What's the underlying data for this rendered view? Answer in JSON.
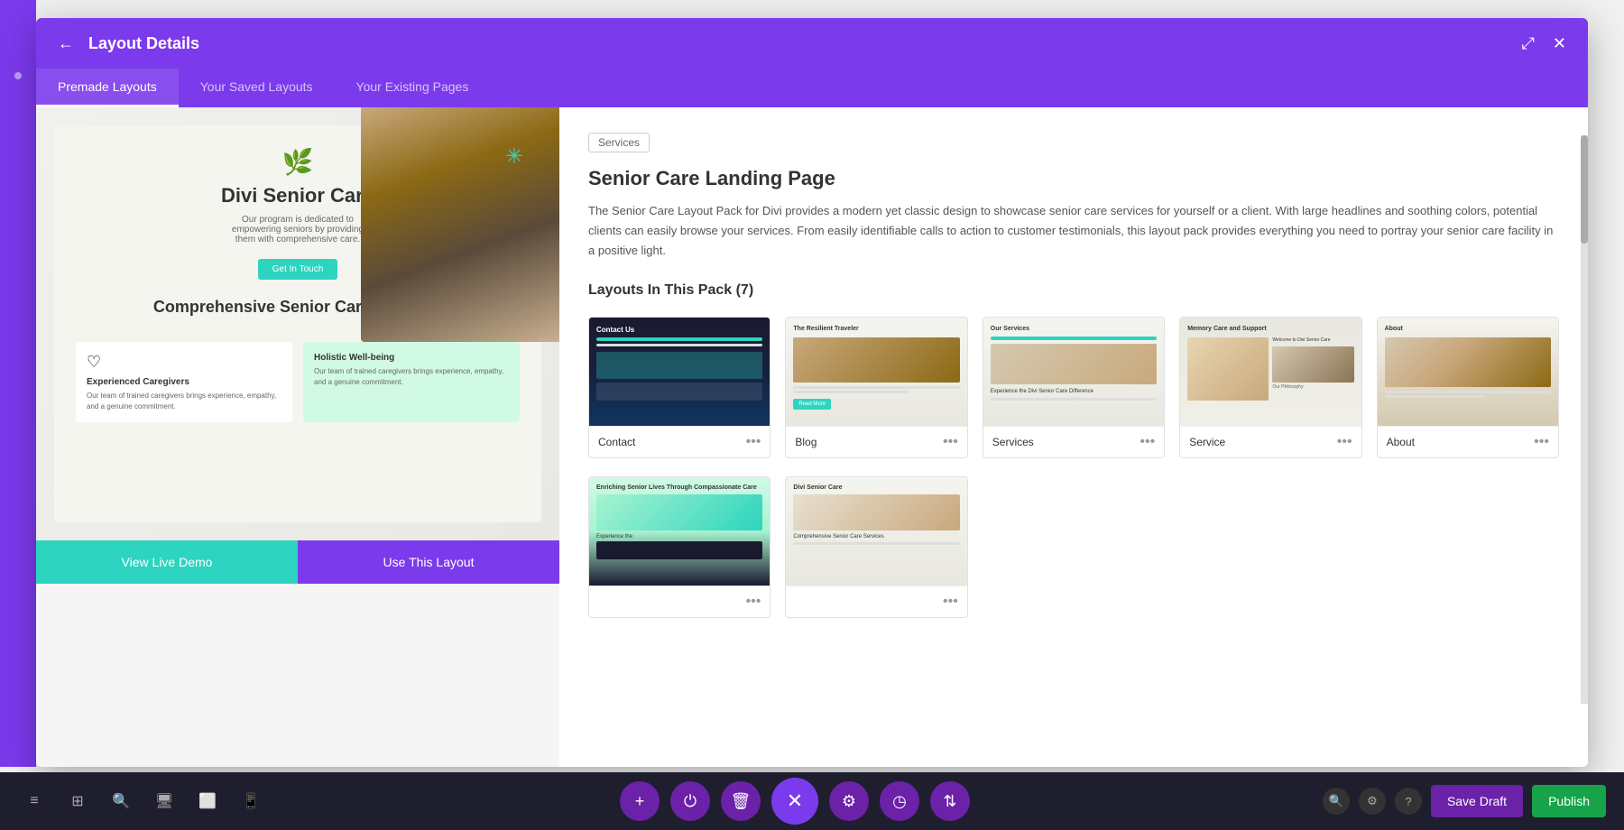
{
  "header": {
    "back_icon": "←",
    "title": "Layout Details",
    "resize_icon": "⤢",
    "close_icon": "✕"
  },
  "tabs": [
    {
      "id": "premade",
      "label": "Premade Layouts",
      "active": true
    },
    {
      "id": "saved",
      "label": "Your Saved Layouts",
      "active": false
    },
    {
      "id": "existing",
      "label": "Your Existing Pages",
      "active": false
    }
  ],
  "pack": {
    "tag": "Services",
    "title": "Senior Care Landing Page",
    "description": "The Senior Care Layout Pack for Divi provides a modern yet classic design to showcase senior care services for yourself or a client. With large headlines and soothing colors, potential clients can easily browse your services. From easily identifiable calls to action to customer testimonials, this layout pack provides everything you need to portray your senior care facility in a positive light.",
    "layouts_header": "Layouts In This Pack (7)"
  },
  "layouts": [
    {
      "id": "contact",
      "name": "Contact",
      "thumb_type": "contact"
    },
    {
      "id": "blog",
      "name": "Blog",
      "thumb_type": "blog"
    },
    {
      "id": "services",
      "name": "Services",
      "thumb_type": "services"
    },
    {
      "id": "service",
      "name": "Service",
      "thumb_type": "service"
    },
    {
      "id": "about",
      "name": "About",
      "thumb_type": "about"
    },
    {
      "id": "home1",
      "name": "",
      "thumb_type": "home1"
    },
    {
      "id": "home2",
      "name": "",
      "thumb_type": "home2"
    }
  ],
  "preview": {
    "brand_name": "Divi Senior Care",
    "brand_subtitle": "Our program is dedicated to empowering seniors by providing them with comprehensive care.",
    "btn_label": "Get In Touch",
    "section_title": "Comprehensive Senior Care Services",
    "card1_icon": "♡",
    "card1_title": "Experienced Caregivers",
    "card1_text": "Our team of trained caregivers brings experience, empathy, and a genuine commitment.",
    "card2_title": "Holistic Well-being",
    "card2_text": "Our team of trained caregivers brings experience, empathy, and a genuine commitment."
  },
  "buttons": {
    "view_demo": "View Live Demo",
    "use_layout": "Use This Layout"
  },
  "toolbar": {
    "plus_icon": "+",
    "power_icon": "⏻",
    "trash_icon": "🗑",
    "close_icon": "✕",
    "settings_icon": "⚙",
    "history_icon": "◷",
    "adjust_icon": "⇅",
    "grid_icon": "⊞",
    "search_icon": "🔍",
    "desktop_icon": "🖥",
    "tablet_icon": "⬜",
    "phone_icon": "📱",
    "save_draft": "Save Draft",
    "publish": "Publish",
    "hamburger_icon": "≡",
    "zoom_icon": "🔍",
    "question_icon": "?"
  }
}
